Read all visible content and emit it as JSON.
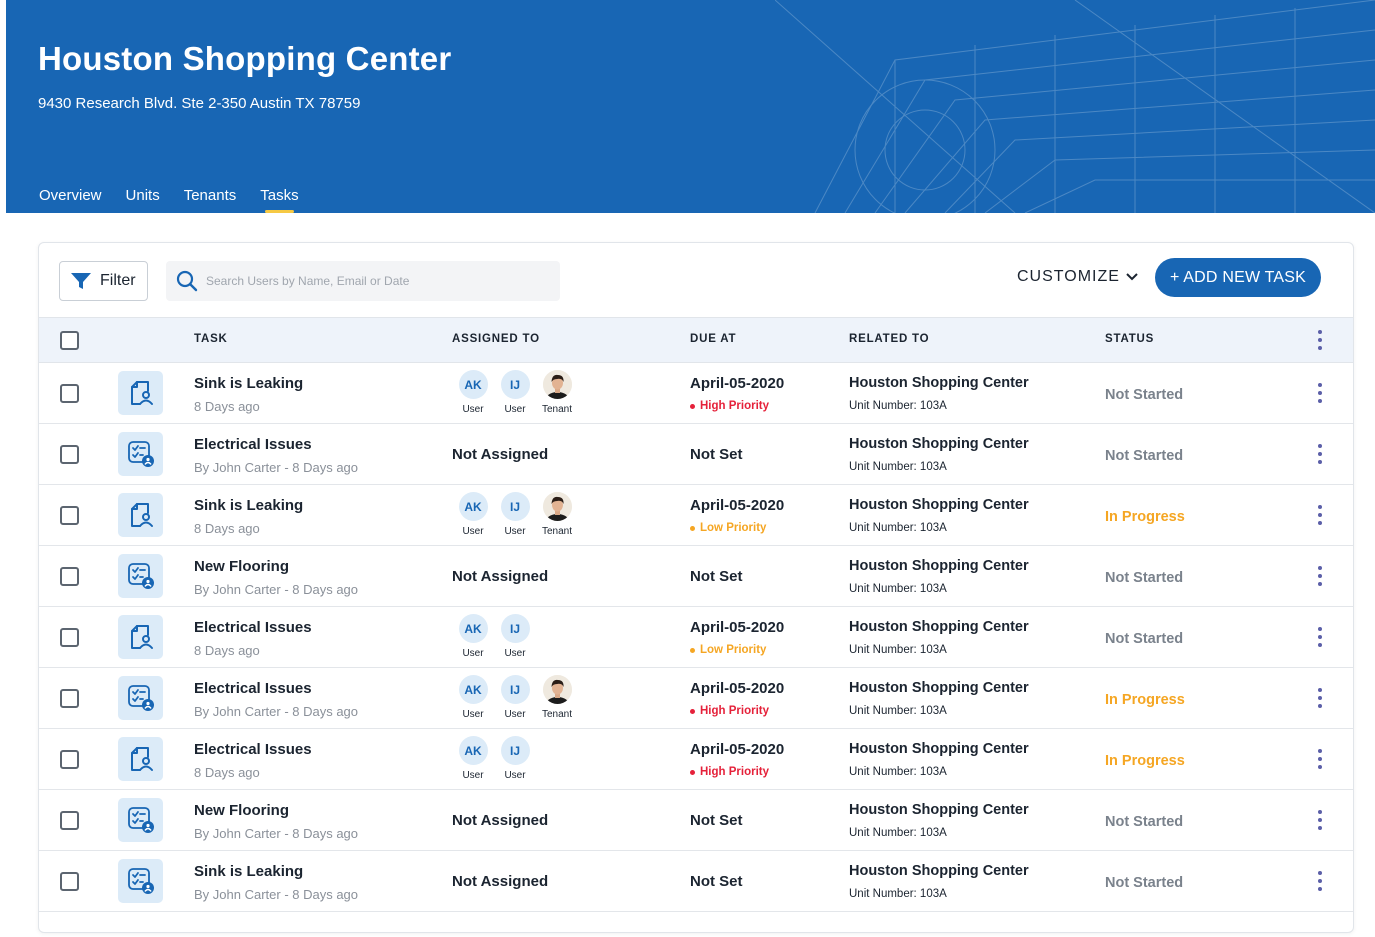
{
  "header": {
    "title": "Houston Shopping Center",
    "address": "9430 Research Blvd. Ste 2-350 Austin TX 78759",
    "tabs": [
      {
        "label": "Overview"
      },
      {
        "label": "Units"
      },
      {
        "label": "Tenants"
      },
      {
        "label": "Tasks",
        "active": true
      }
    ]
  },
  "toolbar": {
    "filter_label": "Filter",
    "search_placeholder": "Search Users by Name, Email or Date",
    "customize_label": "CUSTOMIZE",
    "add_label": "+ ADD NEW TASK"
  },
  "table": {
    "columns": {
      "task": "TASK",
      "assigned": "ASSIGNED TO",
      "due": "DUE AT",
      "related": "RELATED TO",
      "status": "STATUS"
    },
    "rows": [
      {
        "icon": "document-user-icon",
        "title": "Sink is Leaking",
        "subtitle": "8 Days ago",
        "assignees": [
          {
            "initials": "AK",
            "role": "User"
          },
          {
            "initials": "IJ",
            "role": "User"
          },
          {
            "photo": true,
            "role": "Tenant"
          }
        ],
        "due": "April-05-2020",
        "priority": "High Priority",
        "priority_color": "#e5213a",
        "related": "Houston Shopping Center",
        "unit": "Unit Number: 103A",
        "status": "Not Started",
        "status_color": "#7a828c"
      },
      {
        "icon": "checklist-user-icon",
        "title": "Electrical Issues",
        "subtitle": "By John Carter - 8 Days ago",
        "assignees": [],
        "not_assigned": "Not Assigned",
        "due": "Not Set",
        "related": "Houston Shopping Center",
        "unit": "Unit Number: 103A",
        "status": "Not Started",
        "status_color": "#7a828c"
      },
      {
        "icon": "document-user-icon",
        "title": "Sink is Leaking",
        "subtitle": "8 Days ago",
        "assignees": [
          {
            "initials": "AK",
            "role": "User"
          },
          {
            "initials": "IJ",
            "role": "User"
          },
          {
            "photo": true,
            "role": "Tenant"
          }
        ],
        "due": "April-05-2020",
        "priority": "Low Priority",
        "priority_color": "#f5a623",
        "related": "Houston Shopping Center",
        "unit": "Unit Number: 103A",
        "status": "In Progress",
        "status_color": "#f5a623"
      },
      {
        "icon": "checklist-user-icon",
        "title": "New Flooring",
        "subtitle": "By John Carter - 8 Days ago",
        "assignees": [],
        "not_assigned": "Not Assigned",
        "due": "Not Set",
        "related": "Houston Shopping Center",
        "unit": "Unit Number: 103A",
        "status": "Not Started",
        "status_color": "#7a828c"
      },
      {
        "icon": "document-user-icon",
        "title": "Electrical Issues",
        "subtitle": "8 Days ago",
        "assignees": [
          {
            "initials": "AK",
            "role": "User"
          },
          {
            "initials": "IJ",
            "role": "User"
          }
        ],
        "due": "April-05-2020",
        "priority": "Low Priority",
        "priority_color": "#f5a623",
        "related": "Houston Shopping Center",
        "unit": "Unit Number: 103A",
        "status": "Not Started",
        "status_color": "#7a828c"
      },
      {
        "icon": "checklist-user-icon",
        "title": "Electrical Issues",
        "subtitle": "By John Carter - 8 Days ago",
        "assignees": [
          {
            "initials": "AK",
            "role": "User"
          },
          {
            "initials": "IJ",
            "role": "User"
          },
          {
            "photo": true,
            "role": "Tenant"
          }
        ],
        "due": "April-05-2020",
        "priority": "High Priority",
        "priority_color": "#e5213a",
        "related": "Houston Shopping Center",
        "unit": "Unit Number: 103A",
        "status": "In Progress",
        "status_color": "#f5a623"
      },
      {
        "icon": "document-user-icon",
        "title": "Electrical Issues",
        "subtitle": "8 Days ago",
        "assignees": [
          {
            "initials": "AK",
            "role": "User"
          },
          {
            "initials": "IJ",
            "role": "User"
          }
        ],
        "due": "April-05-2020",
        "priority": "High Priority",
        "priority_color": "#e5213a",
        "related": "Houston Shopping Center",
        "unit": "Unit Number: 103A",
        "status": "In Progress",
        "status_color": "#f5a623"
      },
      {
        "icon": "checklist-user-icon",
        "title": "New Flooring",
        "subtitle": "By John Carter - 8 Days ago",
        "assignees": [],
        "not_assigned": "Not Assigned",
        "due": "Not Set",
        "related": "Houston Shopping Center",
        "unit": "Unit Number: 103A",
        "status": "Not Started",
        "status_color": "#7a828c"
      },
      {
        "icon": "checklist-user-icon",
        "title": "Sink is Leaking",
        "subtitle": "By John Carter - 8 Days ago",
        "assignees": [],
        "not_assigned": "Not Assigned",
        "due": "Not Set",
        "related": "Houston Shopping Center",
        "unit": "Unit Number: 103A",
        "status": "Not Started",
        "status_color": "#7a828c"
      }
    ]
  },
  "colors": {
    "brand": "#1866b4",
    "accent_underline": "#f6c944",
    "high_priority": "#e5213a",
    "low_priority": "#f5a623",
    "in_progress": "#f5a623",
    "not_started": "#7a828c"
  }
}
